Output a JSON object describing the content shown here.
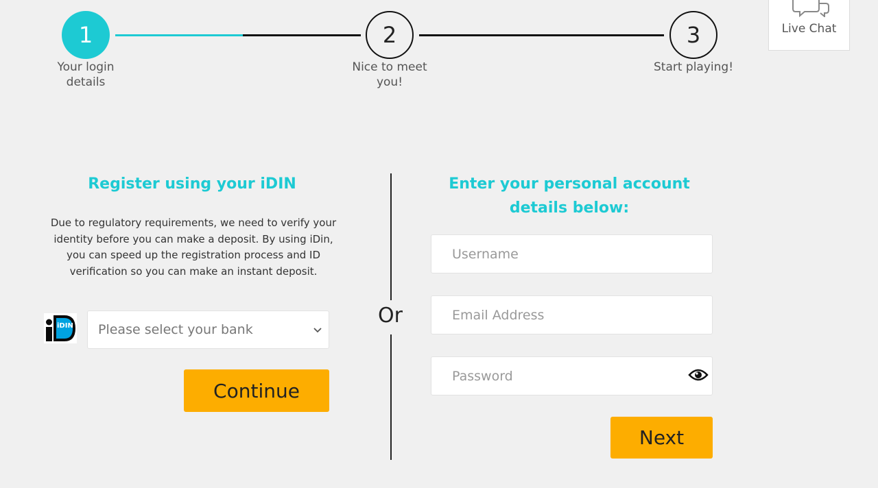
{
  "stepper": {
    "steps": [
      {
        "number": "1",
        "label_line1": "Your login",
        "label_line2": "details"
      },
      {
        "number": "2",
        "label_line1": "Nice to meet",
        "label_line2": "you!"
      },
      {
        "number": "3",
        "label_line1": "Start playing!",
        "label_line2": ""
      }
    ],
    "active_color": "#1dcad3",
    "progress_fraction": 0.41
  },
  "live_chat": {
    "label": "Live Chat",
    "icon": "chat-bubbles-icon"
  },
  "idin_section": {
    "heading": "Register using your iDIN",
    "intro_lines": [
      "Due to regulatory requirements, we need to verify your",
      "identity before you can make a deposit. By using iDin,",
      "you can speed up the registration process and ID",
      "verification so you can make an instant deposit."
    ],
    "logo_text": "iDIN",
    "bank_select": {
      "selected": "Please select your bank"
    },
    "continue_label": "Continue"
  },
  "divider": {
    "label": "Or"
  },
  "account_section": {
    "heading_line1": "Enter your personal account",
    "heading_line2": "details below:",
    "username_placeholder": "Username",
    "email_placeholder": "Email Address",
    "password_placeholder": "Password",
    "next_label": "Next"
  },
  "colors": {
    "accent": "#1dcad3",
    "button": "#fdad00",
    "background": "#f0f0f0"
  }
}
